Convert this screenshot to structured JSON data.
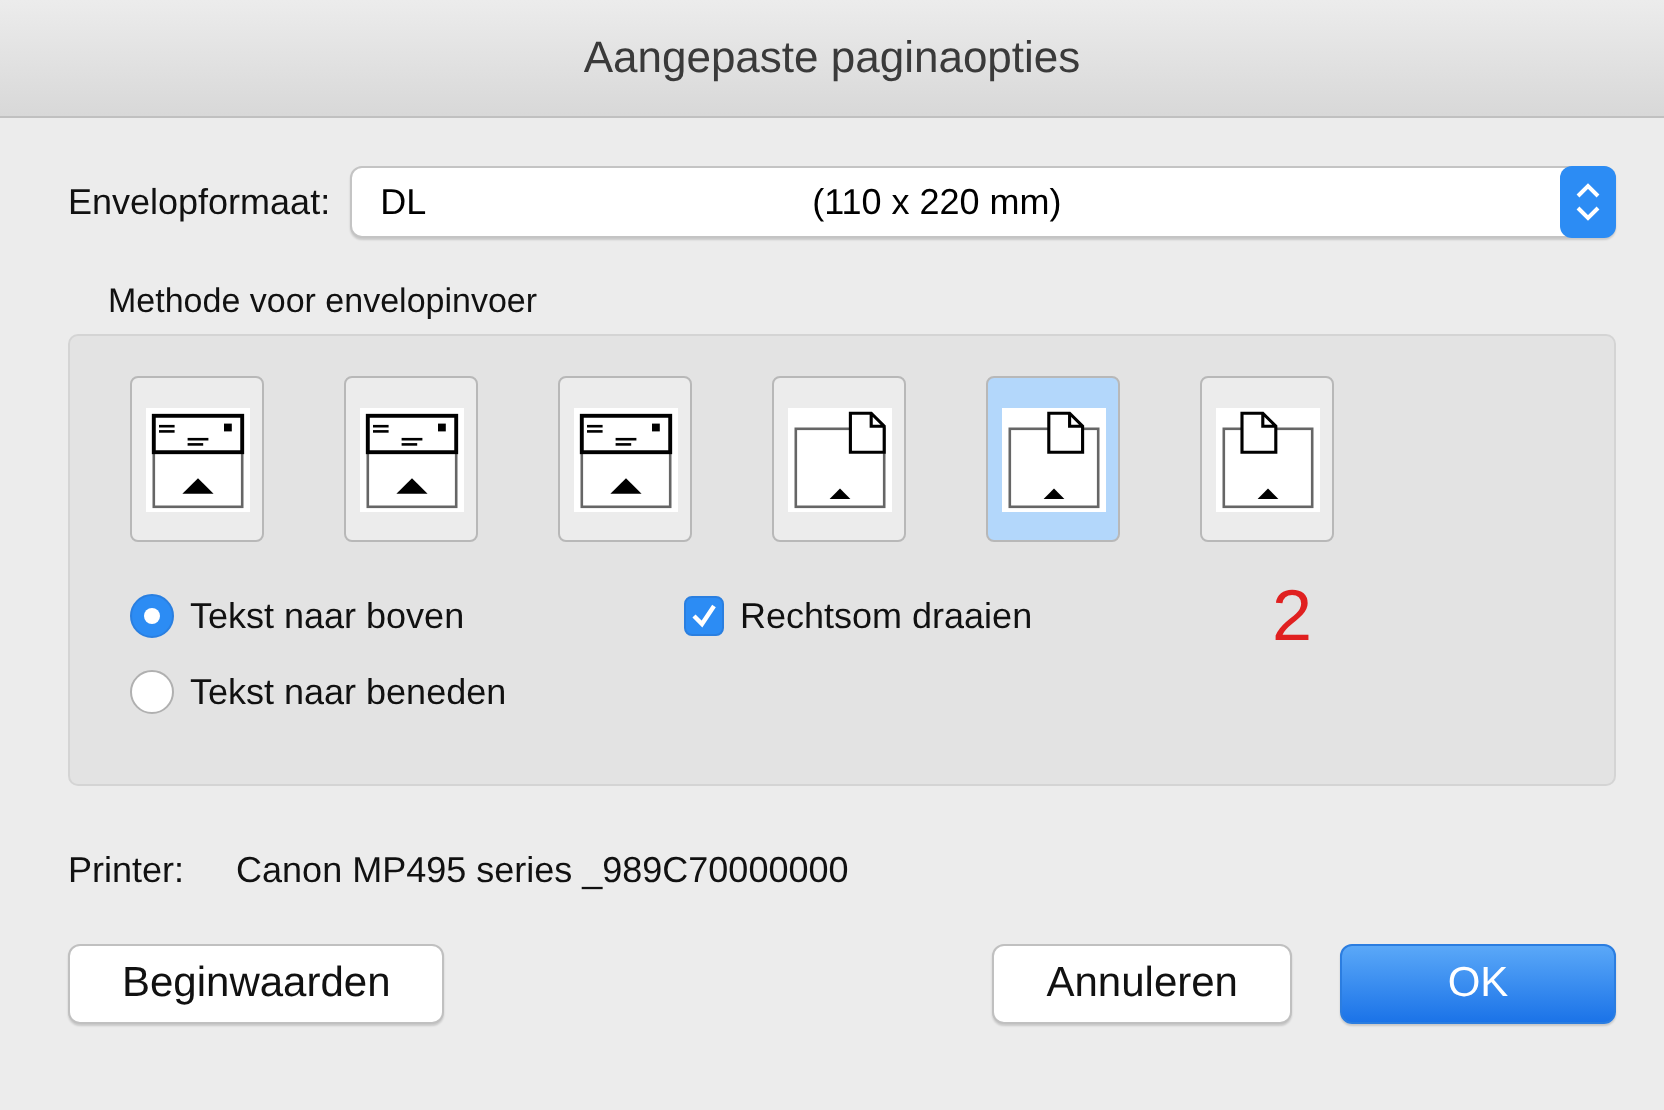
{
  "window": {
    "title": "Aangepaste paginaopties"
  },
  "envelope_format": {
    "label": "Envelopformaat:",
    "value": "DL",
    "size": "(110 x 220 mm)"
  },
  "feed_method": {
    "title": "Methode voor envelopinvoer",
    "options": [
      {
        "kind": "letter",
        "selected": false
      },
      {
        "kind": "letter",
        "selected": false
      },
      {
        "kind": "letter",
        "selected": false
      },
      {
        "kind": "sheet-right",
        "selected": false
      },
      {
        "kind": "sheet-center",
        "selected": true
      },
      {
        "kind": "sheet-left",
        "selected": false
      }
    ],
    "orientation": [
      {
        "label": "Tekst naar boven",
        "selected": true
      },
      {
        "label": "Tekst naar beneden",
        "selected": false
      }
    ],
    "rotate": {
      "label": "Rechtsom draaien",
      "checked": true
    },
    "annotation": "2"
  },
  "printer": {
    "label": "Printer:",
    "value": "Canon MP495 series _989C70000000"
  },
  "buttons": [
    {
      "label": "Beginwaarden",
      "kind": "secondary"
    },
    {
      "label": "Annuleren",
      "kind": "secondary"
    },
    {
      "label": "OK",
      "kind": "primary"
    }
  ]
}
